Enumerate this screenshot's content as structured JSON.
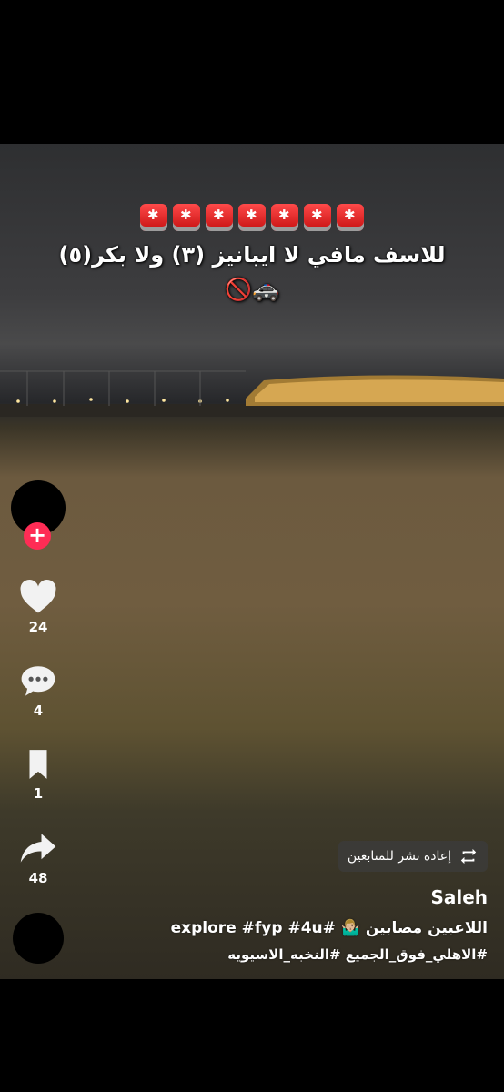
{
  "overlay": {
    "emoji_line": "🚨🚨🚨🚨🚨🚨🚨",
    "line1": "للاسف مافي لا ايبانيز (٣) ولا بكر(٥)",
    "line2": "🚫🚓"
  },
  "actions": {
    "likes": "24",
    "comments": "4",
    "saves": "1",
    "shares": "48"
  },
  "post": {
    "repost_label": "إعادة نشر للمتابعين",
    "username": "Saleh",
    "description_line1": "اللاعبين مصابين 🤷🏼‍♂️ #explore #fyp #4u",
    "description_line2": "#الاهلي_فوق_الجميع  #النخبه_الاسيويه"
  },
  "colors": {
    "follow": "#fe2c55",
    "background": "#000000"
  }
}
